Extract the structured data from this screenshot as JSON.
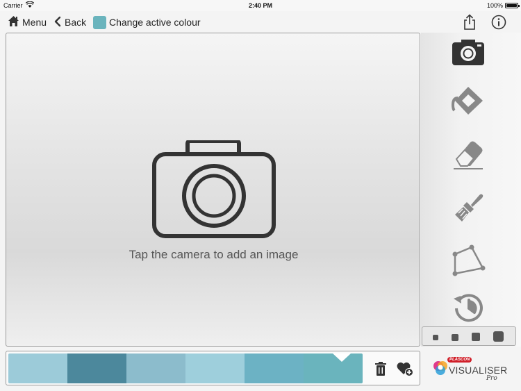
{
  "status_bar": {
    "carrier": "Carrier",
    "time": "2:40 PM",
    "battery": "100%"
  },
  "nav": {
    "menu_label": "Menu",
    "back_label": "Back",
    "change_colour_label": "Change active colour",
    "active_colour": "#6ab4bd",
    "icons": [
      "home-icon",
      "chevron-left-icon",
      "share-icon",
      "info-icon"
    ]
  },
  "canvas": {
    "hint": "Tap the camera to add an image",
    "icon": "camera-icon"
  },
  "toolbar": {
    "tools": [
      {
        "name": "camera",
        "icon": "camera-icon",
        "active": true
      },
      {
        "name": "fill",
        "icon": "fill-bucket-icon",
        "active": false
      },
      {
        "name": "eraser",
        "icon": "eraser-icon",
        "active": false
      },
      {
        "name": "brush",
        "icon": "paint-brush-icon",
        "active": false
      },
      {
        "name": "polygon",
        "icon": "polygon-icon",
        "active": false
      },
      {
        "name": "history",
        "icon": "history-icon",
        "active": false
      }
    ],
    "brush_sizes": [
      "small",
      "medium",
      "large",
      "xlarge"
    ]
  },
  "palette": {
    "colours": [
      "#9ccbd9",
      "#4c889c",
      "#8cbccc",
      "#9ecfdc",
      "#6cb2c4",
      "#6ab4bd"
    ],
    "active_index": 5,
    "icons": [
      "trash-icon",
      "heart-add-icon"
    ]
  },
  "logo": {
    "brand": "PLASCON",
    "product": "VISUALISER",
    "edition": "Pro"
  }
}
